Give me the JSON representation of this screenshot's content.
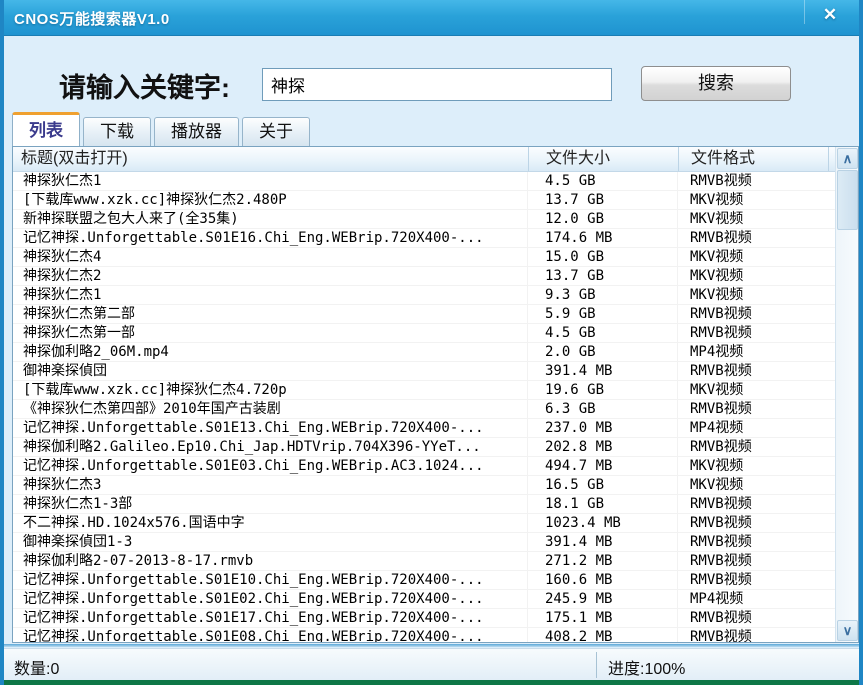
{
  "window": {
    "title": "CNOS万能搜索器V1.0"
  },
  "icons": {
    "close": "✕",
    "scroll_up": "∧",
    "scroll_down": "∨"
  },
  "search": {
    "label": "请输入关键字:",
    "value": "神探",
    "button_label": "搜索"
  },
  "tabs": [
    {
      "label": "列表",
      "active": true
    },
    {
      "label": "下载",
      "active": false
    },
    {
      "label": "播放器",
      "active": false
    },
    {
      "label": "关于",
      "active": false
    }
  ],
  "table": {
    "columns": [
      "标题(双击打开)",
      "文件大小",
      "文件格式"
    ],
    "rows": [
      {
        "title": "神探狄仁杰1",
        "size": "4.5 GB",
        "format": "RMVB视频"
      },
      {
        "title": "[下载库www.xzk.cc]神探狄仁杰2.480P",
        "size": "13.7 GB",
        "format": "MKV视频"
      },
      {
        "title": "新神探联盟之包大人来了(全35集)",
        "size": "12.0 GB",
        "format": "MKV视频"
      },
      {
        "title": "记忆神探.Unforgettable.S01E16.Chi_Eng.WEBrip.720X400-...",
        "size": "174.6 MB",
        "format": "RMVB视频"
      },
      {
        "title": "神探狄仁杰4",
        "size": "15.0 GB",
        "format": "MKV视频"
      },
      {
        "title": "神探狄仁杰2",
        "size": "13.7 GB",
        "format": "MKV视频"
      },
      {
        "title": "神探狄仁杰1",
        "size": "9.3 GB",
        "format": "MKV视频"
      },
      {
        "title": "神探狄仁杰第二部",
        "size": "5.9 GB",
        "format": "RMVB视频"
      },
      {
        "title": "神探狄仁杰第一部",
        "size": "4.5 GB",
        "format": "RMVB视频"
      },
      {
        "title": "神探伽利略2_06M.mp4",
        "size": "2.0 GB",
        "format": "MP4视频"
      },
      {
        "title": "御神楽探偵団",
        "size": "391.4 MB",
        "format": "RMVB视频"
      },
      {
        "title": "[下载库www.xzk.cc]神探狄仁杰4.720p",
        "size": "19.6 GB",
        "format": "MKV视频"
      },
      {
        "title": "《神探狄仁杰第四部》2010年国产古装剧",
        "size": "6.3 GB",
        "format": "RMVB视频"
      },
      {
        "title": "记忆神探.Unforgettable.S01E13.Chi_Eng.WEBrip.720X400-...",
        "size": "237.0 MB",
        "format": "MP4视频"
      },
      {
        "title": "神探伽利略2.Galileo.Ep10.Chi_Jap.HDTVrip.704X396-YYeT...",
        "size": "202.8 MB",
        "format": "RMVB视频"
      },
      {
        "title": "记忆神探.Unforgettable.S01E03.Chi_Eng.WEBrip.AC3.1024...",
        "size": "494.7 MB",
        "format": "MKV视频"
      },
      {
        "title": "神探狄仁杰3",
        "size": "16.5 GB",
        "format": "MKV视频"
      },
      {
        "title": "神探狄仁杰1-3部",
        "size": "18.1 GB",
        "format": "RMVB视频"
      },
      {
        "title": "不二神探.HD.1024x576.国语中字",
        "size": "1023.4 MB",
        "format": "RMVB视频"
      },
      {
        "title": "御神楽探偵団1-3",
        "size": "391.4 MB",
        "format": "RMVB视频"
      },
      {
        "title": "神探伽利略2-07-2013-8-17.rmvb",
        "size": "271.2 MB",
        "format": "RMVB视频"
      },
      {
        "title": "记忆神探.Unforgettable.S01E10.Chi_Eng.WEBrip.720X400-...",
        "size": "160.6 MB",
        "format": "RMVB视频"
      },
      {
        "title": "记忆神探.Unforgettable.S01E02.Chi_Eng.WEBrip.720X400-...",
        "size": "245.9 MB",
        "format": "MP4视频"
      },
      {
        "title": "记忆神探.Unforgettable.S01E17.Chi_Eng.WEBrip.720X400-...",
        "size": "175.1 MB",
        "format": "RMVB视频"
      },
      {
        "title": "记忆神探.Unforgettable.S01E08.Chi_Eng.WEBrip.720X400-...",
        "size": "408.2 MB",
        "format": "RMVB视频"
      }
    ]
  },
  "statusbar": {
    "count_label": "数量:0",
    "progress_label": "进度:100%"
  }
}
